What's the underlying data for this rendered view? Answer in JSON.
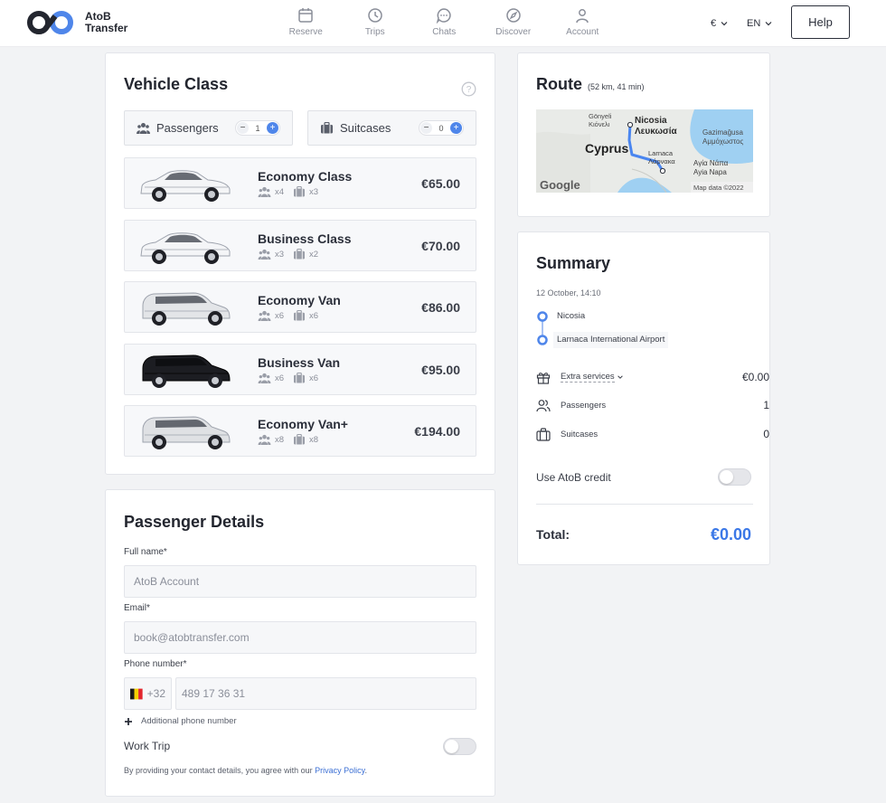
{
  "header": {
    "logo_line1": "AtoB",
    "logo_line2": "Transfer",
    "nav": [
      {
        "label": "Reserve",
        "icon": "calendar-icon"
      },
      {
        "label": "Trips",
        "icon": "clock-icon"
      },
      {
        "label": "Chats",
        "icon": "chat-icon"
      },
      {
        "label": "Discover",
        "icon": "compass-icon"
      },
      {
        "label": "Account",
        "icon": "user-icon"
      }
    ],
    "currency": "€",
    "language": "EN",
    "help": "Help"
  },
  "vehicle_class": {
    "title": "Vehicle Class",
    "passengers_label": "Passengers",
    "passengers_value": "1",
    "suitcases_label": "Suitcases",
    "suitcases_value": "0",
    "vehicles": [
      {
        "name": "Economy Class",
        "pax": "x4",
        "bags": "x3",
        "price": "€65.00",
        "color": "#f4f5f7"
      },
      {
        "name": "Business Class",
        "pax": "x3",
        "bags": "x2",
        "price": "€70.00",
        "color": "#f4f5f7"
      },
      {
        "name": "Economy Van",
        "pax": "x6",
        "bags": "x6",
        "price": "€86.00",
        "color": "#e3e5e8"
      },
      {
        "name": "Business Van",
        "pax": "x6",
        "bags": "x6",
        "price": "€95.00",
        "color": "#1c1d22"
      },
      {
        "name": "Economy Van+",
        "pax": "x8",
        "bags": "x8",
        "price": "€194.00",
        "color": "#dfe1e4"
      }
    ]
  },
  "passenger_details": {
    "title": "Passenger Details",
    "full_name_label": "Full name*",
    "full_name_placeholder": "AtoB Account",
    "email_label": "Email*",
    "email_placeholder": "book@atobtransfer.com",
    "phone_label": "Phone number*",
    "phone_code": "+32",
    "phone_placeholder": "489 17 36 31",
    "additional_phone": "Additional phone number",
    "work_trip": "Work Trip",
    "consent_text": "By providing your contact details, you agree with our ",
    "privacy_link": "Privacy Policy",
    "consent_end": "."
  },
  "route": {
    "title": "Route",
    "meta": "(52 km, 41 min)",
    "map": {
      "labels": [
        "Gönyeli",
        "Κιόνελι",
        "Nicosia",
        "Λευκωσία",
        "Gazimağusa",
        "Αμμόχωστος",
        "Cyprus",
        "Larnaca",
        "Λάρνακα",
        "Αγία Νάπα",
        "Ayia Napa"
      ],
      "brand": "Google",
      "credit": "Map data ©2022"
    }
  },
  "summary": {
    "title": "Summary",
    "datetime": "12 October, 14:10",
    "from": "Nicosia",
    "to": "Larnaca International Airport",
    "extra_services_label": "Extra services",
    "extra_services_value": "€0.00",
    "passengers_label": "Passengers",
    "passengers_value": "1",
    "suitcases_label": "Suitcases",
    "suitcases_value": "0",
    "credit_label": "Use AtoB credit",
    "total_label": "Total:",
    "total_value": "€0.00"
  },
  "colors": {
    "accent": "#4f86ea",
    "total": "#3b78e7"
  }
}
